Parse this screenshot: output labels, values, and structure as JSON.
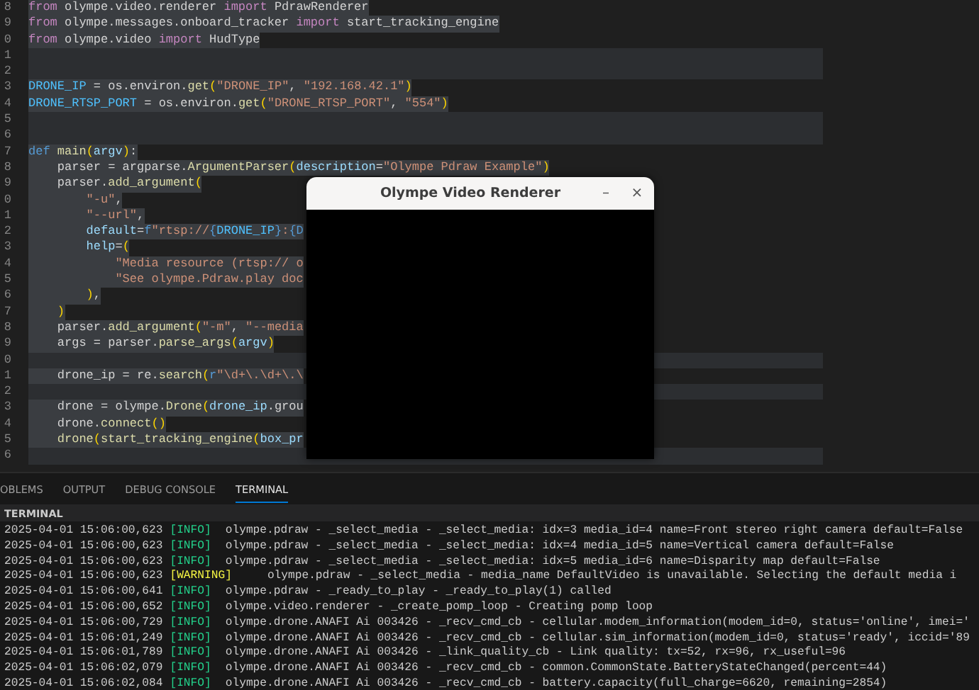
{
  "editor": {
    "lines": [
      {
        "number": "8",
        "tokens": [
          {
            "kind": "k",
            "text": "from"
          },
          {
            "kind": "p",
            "text": " olympe.video.renderer "
          },
          {
            "kind": "k",
            "text": "import"
          },
          {
            "kind": "p",
            "text": " PdrawRenderer"
          }
        ]
      },
      {
        "number": "9",
        "tokens": [
          {
            "kind": "k",
            "text": "from"
          },
          {
            "kind": "p",
            "text": " olympe.messages.onboard_tracker "
          },
          {
            "kind": "k",
            "text": "import"
          },
          {
            "kind": "p",
            "text": " start_tracking_engine"
          }
        ]
      },
      {
        "number": "0",
        "tokens": [
          {
            "kind": "k",
            "text": "from"
          },
          {
            "kind": "p",
            "text": " olympe.video "
          },
          {
            "kind": "k",
            "text": "import"
          },
          {
            "kind": "p",
            "text": " HudType"
          }
        ]
      },
      {
        "number": "1"
      },
      {
        "number": "2"
      },
      {
        "number": "3",
        "tokens": [
          {
            "kind": "c",
            "text": "DRONE_IP"
          },
          {
            "kind": "p",
            "text": " = os.environ."
          },
          {
            "kind": "f",
            "text": "get"
          },
          {
            "kind": "b",
            "text": "("
          },
          {
            "kind": "s",
            "text": "\"DRONE_IP\""
          },
          {
            "kind": "p",
            "text": ", "
          },
          {
            "kind": "s",
            "text": "\"192.168.42.1\""
          },
          {
            "kind": "b",
            "text": ")"
          }
        ]
      },
      {
        "number": "4",
        "tokens": [
          {
            "kind": "c",
            "text": "DRONE_RTSP_PORT"
          },
          {
            "kind": "p",
            "text": " = os.environ."
          },
          {
            "kind": "f",
            "text": "get"
          },
          {
            "kind": "b",
            "text": "("
          },
          {
            "kind": "s",
            "text": "\"DRONE_RTSP_PORT\""
          },
          {
            "kind": "p",
            "text": ", "
          },
          {
            "kind": "s",
            "text": "\"554\""
          },
          {
            "kind": "b",
            "text": ")"
          }
        ]
      },
      {
        "number": "5"
      },
      {
        "number": "6"
      },
      {
        "number": "7",
        "tokens": [
          {
            "kind": "d",
            "text": "def "
          },
          {
            "kind": "f",
            "text": "main"
          },
          {
            "kind": "b",
            "text": "("
          },
          {
            "kind": "v",
            "text": "argv"
          },
          {
            "kind": "b",
            "text": ")"
          },
          {
            "kind": "p",
            "text": ":"
          }
        ]
      },
      {
        "number": "8",
        "tokens": [
          {
            "kind": "p",
            "text": "    parser = argparse."
          },
          {
            "kind": "f",
            "text": "ArgumentParser"
          },
          {
            "kind": "b",
            "text": "("
          },
          {
            "kind": "v",
            "text": "description"
          },
          {
            "kind": "p",
            "text": "="
          },
          {
            "kind": "s",
            "text": "\"Olympe Pdraw Example\""
          },
          {
            "kind": "b",
            "text": ")"
          }
        ]
      },
      {
        "number": "9",
        "tokens": [
          {
            "kind": "p",
            "text": "    parser."
          },
          {
            "kind": "f",
            "text": "add_argument"
          },
          {
            "kind": "b",
            "text": "("
          }
        ]
      },
      {
        "number": "0",
        "tokens": [
          {
            "kind": "s",
            "text": "        \"-u\""
          },
          {
            "kind": "p",
            "text": ","
          }
        ]
      },
      {
        "number": "1",
        "tokens": [
          {
            "kind": "s",
            "text": "        \"--url\""
          },
          {
            "kind": "p",
            "text": ","
          }
        ]
      },
      {
        "number": "2",
        "tokens": [
          {
            "kind": "v",
            "text": "        default"
          },
          {
            "kind": "p",
            "text": "="
          },
          {
            "kind": "d",
            "text": "f"
          },
          {
            "kind": "s",
            "text": "\"rtsp://"
          },
          {
            "kind": "d",
            "text": "{"
          },
          {
            "kind": "c",
            "text": "DRONE_IP"
          },
          {
            "kind": "d",
            "text": "}"
          },
          {
            "kind": "s",
            "text": ":"
          },
          {
            "kind": "d",
            "text": "{D"
          }
        ]
      },
      {
        "number": "3",
        "tokens": [
          {
            "kind": "v",
            "text": "        help"
          },
          {
            "kind": "p",
            "text": "="
          },
          {
            "kind": "b",
            "text": "("
          }
        ]
      },
      {
        "number": "4",
        "tokens": [
          {
            "kind": "s",
            "text": "            \"Media resource (rtsp:// o"
          }
        ]
      },
      {
        "number": "5",
        "tokens": [
          {
            "kind": "s",
            "text": "            \"See olympe.Pdraw.play doc"
          }
        ]
      },
      {
        "number": "6",
        "tokens": [
          {
            "kind": "b",
            "text": "        )"
          },
          {
            "kind": "p",
            "text": ","
          }
        ]
      },
      {
        "number": "7",
        "tokens": [
          {
            "kind": "b",
            "text": "    )"
          }
        ]
      },
      {
        "number": "8",
        "tokens": [
          {
            "kind": "p",
            "text": "    parser."
          },
          {
            "kind": "f",
            "text": "add_argument"
          },
          {
            "kind": "b",
            "text": "("
          },
          {
            "kind": "s",
            "text": "\"-m\""
          },
          {
            "kind": "p",
            "text": ", "
          },
          {
            "kind": "s",
            "text": "\"--media"
          }
        ]
      },
      {
        "number": "9",
        "tokens": [
          {
            "kind": "p",
            "text": "    args = parser."
          },
          {
            "kind": "f",
            "text": "parse_args"
          },
          {
            "kind": "b",
            "text": "("
          },
          {
            "kind": "v",
            "text": "argv"
          },
          {
            "kind": "b",
            "text": ")"
          }
        ]
      },
      {
        "number": "0"
      },
      {
        "number": "1",
        "tokens": [
          {
            "kind": "p",
            "text": "    drone_ip = re."
          },
          {
            "kind": "f",
            "text": "search"
          },
          {
            "kind": "b",
            "text": "("
          },
          {
            "kind": "d",
            "text": "r"
          },
          {
            "kind": "s",
            "text": "\"\\d+\\.\\d+\\.\\"
          }
        ]
      },
      {
        "number": "2"
      },
      {
        "number": "3",
        "tokens": [
          {
            "kind": "p",
            "text": "    drone = olympe."
          },
          {
            "kind": "f",
            "text": "Drone"
          },
          {
            "kind": "b",
            "text": "("
          },
          {
            "kind": "v",
            "text": "drone_ip"
          },
          {
            "kind": "p",
            "text": ".grou"
          }
        ]
      },
      {
        "number": "4",
        "tokens": [
          {
            "kind": "p",
            "text": "    drone."
          },
          {
            "kind": "f",
            "text": "connect"
          },
          {
            "kind": "b",
            "text": "()"
          }
        ]
      },
      {
        "number": "5",
        "tokens": [
          {
            "kind": "f",
            "text": "    drone"
          },
          {
            "kind": "b",
            "text": "("
          },
          {
            "kind": "f",
            "text": "start_tracking_engine"
          },
          {
            "kind": "b",
            "text": "("
          },
          {
            "kind": "v",
            "text": "box_pr"
          }
        ]
      },
      {
        "number": "6"
      }
    ]
  },
  "window": {
    "title": "Olympe Video Renderer",
    "minimize": "–",
    "close": "×"
  },
  "panel": {
    "tabs": [
      {
        "label": "OBLEMS",
        "selected": false
      },
      {
        "label": "OUTPUT",
        "selected": false
      },
      {
        "label": "DEBUG CONSOLE",
        "selected": false
      },
      {
        "label": "TERMINAL",
        "selected": true
      }
    ],
    "header": "TERMINAL",
    "log": [
      {
        "time": "2025-04-01 15:06:00,623",
        "level": "[INFO]",
        "kind": "info",
        "message": "olympe.pdraw - _select_media - _select_media: idx=3 media_id=4 name=Front stereo right camera default=False"
      },
      {
        "time": "2025-04-01 15:06:00,623",
        "level": "[INFO]",
        "kind": "info",
        "message": "olympe.pdraw - _select_media - _select_media: idx=4 media_id=5 name=Vertical camera default=False"
      },
      {
        "time": "2025-04-01 15:06:00,623",
        "level": "[INFO]",
        "kind": "info",
        "message": "olympe.pdraw - _select_media - _select_media: idx=5 media_id=6 name=Disparity map default=False"
      },
      {
        "time": "2025-04-01 15:06:00,623",
        "level": "[WARNING]",
        "kind": "warning",
        "message": "olympe.pdraw - _select_media - media_name DefaultVideo is unavailable. Selecting the default media i"
      },
      {
        "time": "2025-04-01 15:06:00,641",
        "level": "[INFO]",
        "kind": "info",
        "message": "olympe.pdraw - _ready_to_play - _ready_to_play(1) called"
      },
      {
        "time": "2025-04-01 15:06:00,652",
        "level": "[INFO]",
        "kind": "info",
        "message": "olympe.video.renderer - _create_pomp_loop - Creating pomp loop"
      },
      {
        "time": "2025-04-01 15:06:00,729",
        "level": "[INFO]",
        "kind": "info",
        "message": "olympe.drone.ANAFI Ai 003426 - _recv_cmd_cb - cellular.modem_information(modem_id=0, status='online', imei='"
      },
      {
        "time": "2025-04-01 15:06:01,249",
        "level": "[INFO]",
        "kind": "info",
        "message": "olympe.drone.ANAFI Ai 003426 - _recv_cmd_cb - cellular.sim_information(modem_id=0, status='ready', iccid='89"
      },
      {
        "time": "2025-04-01 15:06:01,789",
        "level": "[INFO]",
        "kind": "info",
        "message": "olympe.drone.ANAFI Ai 003426 - _link_quality_cb - Link quality: tx=52, rx=96, rx_useful=96"
      },
      {
        "time": "2025-04-01 15:06:02,079",
        "level": "[INFO]",
        "kind": "info",
        "message": "olympe.drone.ANAFI Ai 003426 - _recv_cmd_cb - common.CommonState.BatteryStateChanged(percent=44)"
      },
      {
        "time": "2025-04-01 15:06:02,084",
        "level": "[INFO]",
        "kind": "info",
        "message": "olympe.drone.ANAFI Ai 003426 - _recv_cmd_cb - battery.capacity(full_charge=6620, remaining=2854)"
      }
    ]
  }
}
